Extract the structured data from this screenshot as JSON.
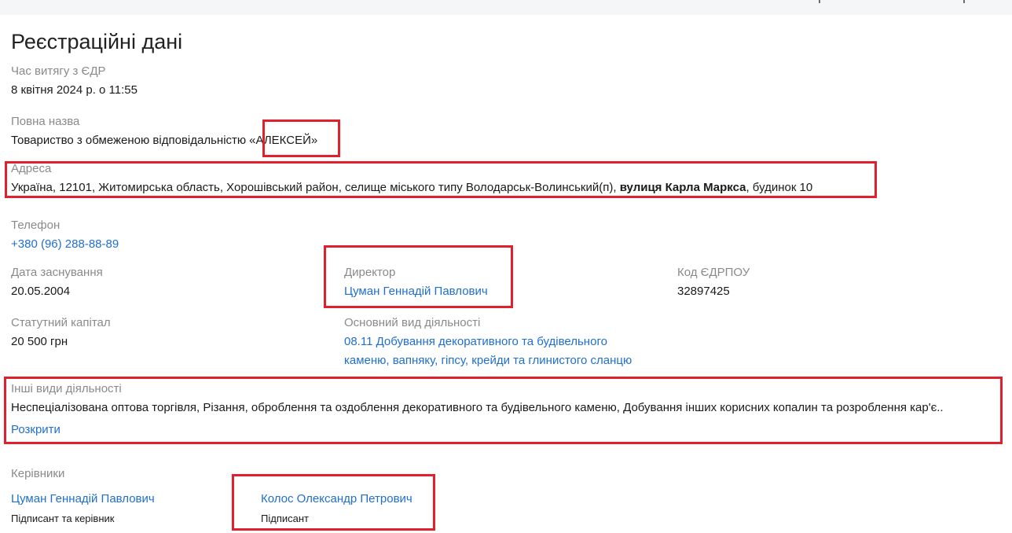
{
  "page": {
    "title": "Реєстраційні дані"
  },
  "extract_time": {
    "label": "Час витягу з ЄДР",
    "value": "8 квітня 2024 р. о 11:55"
  },
  "full_name": {
    "label": "Повна назва",
    "prefix": "Товариство з обмеженою відповідальністю",
    "name": "«АЛЕКСЕЙ»"
  },
  "address": {
    "label": "Адреса",
    "part1": "Україна, 12101, Житомирська область, Хорошівський район, селище міського типу Володарськ-Волинський(п), ",
    "street": "вулиця Карла Маркса",
    "part2": ", будинок 10"
  },
  "phone": {
    "label": "Телефон",
    "value": "+380 (96) 288-88-89"
  },
  "founding_date": {
    "label": "Дата заснування",
    "value": "20.05.2004"
  },
  "director": {
    "label": "Директор",
    "value": "Цуман Геннадій Павлович"
  },
  "edrpou": {
    "label": "Код ЄДРПОУ",
    "value": "32897425"
  },
  "capital": {
    "label": "Статутний капітал",
    "value": "20 500 грн"
  },
  "main_activity": {
    "label": "Основний вид діяльності",
    "line1": "08.11 Добування декоративного та будівельного",
    "line2": "каменю, вапняку, гіпсу, крейди та глинистого сланцю"
  },
  "other_activities": {
    "label": "Інші види діяльності",
    "value": "Неспеціалізована оптова торгівля, Різання, оброблення та оздоблення декоративного та будівельного каменю, Добування інших корисних копалин та розроблення кар'є..",
    "expand_label": "Розкрити"
  },
  "managers": {
    "label": "Керівники",
    "items": [
      {
        "name": "Цуман Геннадій Павлович",
        "role": "Підписант та керівник"
      },
      {
        "name": "Колос Олександр Петрович",
        "role": "Підписант"
      }
    ]
  },
  "colors": {
    "link": "#1f6fd1",
    "label": "#8a8a8a",
    "highlight_border": "#e0202d",
    "top_strip": "#f5f6f7"
  }
}
